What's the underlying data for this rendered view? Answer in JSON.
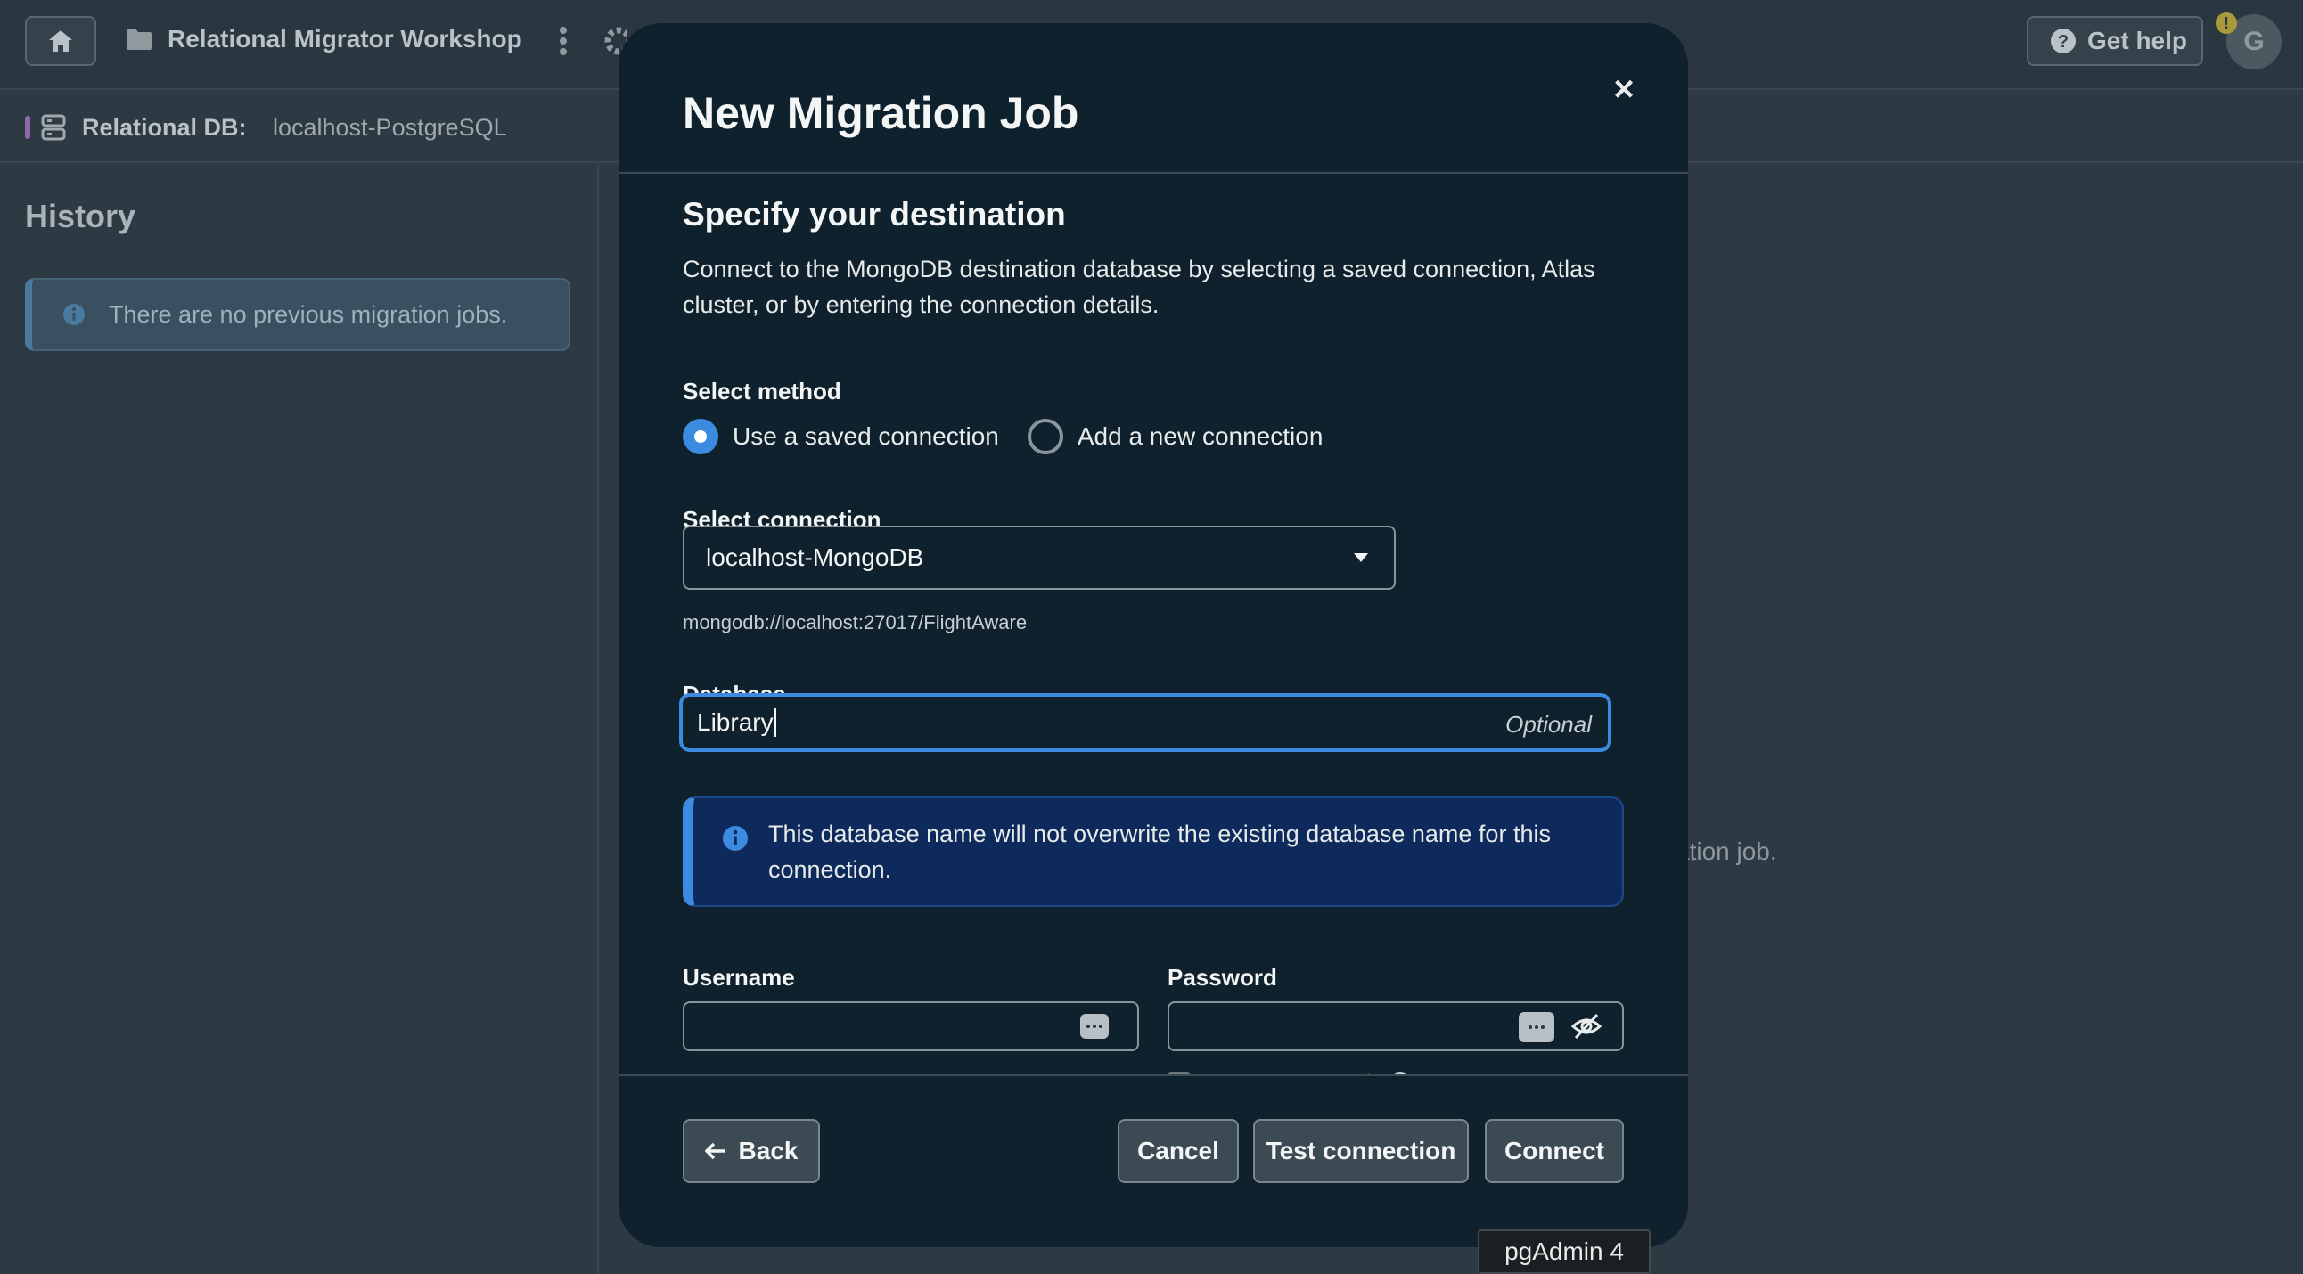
{
  "header": {
    "project_title": "Relational Migrator Workshop",
    "help_label": "Get help",
    "avatar_initial": "G",
    "avatar_badge": "!"
  },
  "subheader": {
    "db_label": "Relational DB:",
    "db_value": "localhost-PostgreSQL"
  },
  "sidebar": {
    "title": "History",
    "empty_message": "There are no previous migration jobs."
  },
  "background_hint": "ation job.",
  "modal": {
    "title": "New Migration Job",
    "close_symbol": "×",
    "section_title": "Specify your destination",
    "section_desc": "Connect to the MongoDB destination database by selecting a saved connection, Atlas cluster, or by entering the connection details.",
    "method_label": "Select method",
    "methods": [
      {
        "label": "Use a saved connection",
        "checked": true
      },
      {
        "label": "Add a new connection",
        "checked": false
      }
    ],
    "connection_label": "Select connection",
    "connection_value": "localhost-MongoDB",
    "connection_string": "mongodb://localhost:27017/FlightAware",
    "database_label": "Database",
    "database_value": "Library",
    "database_optional": "Optional",
    "info_text": "This database name will not overwrite the existing database name for this connection.",
    "username_label": "Username",
    "username_value": "",
    "password_label": "Password",
    "password_value": "",
    "save_password_label": "Save password",
    "save_password_checked": false,
    "buttons": {
      "back": "Back",
      "cancel": "Cancel",
      "test": "Test connection",
      "connect": "Connect"
    }
  },
  "tooltip": "pgAdmin 4",
  "colors": {
    "accent": "#3d8be0",
    "modal_bg": "#0f212d",
    "app_bg": "#2e3a43",
    "info_bg": "#0e2a5c"
  }
}
